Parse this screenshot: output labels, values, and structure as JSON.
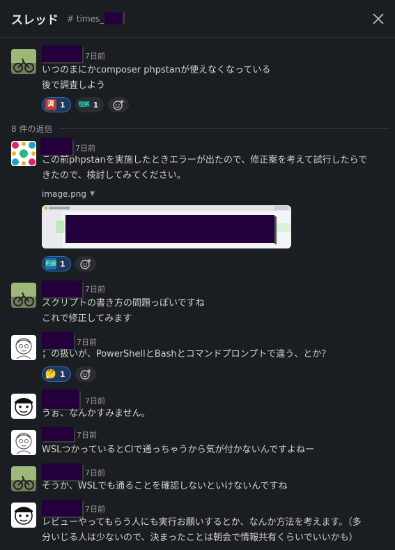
{
  "header": {
    "title": "スレッド",
    "channel": "# times_"
  },
  "parent": {
    "time": "7日前",
    "lines": [
      "いつのまにかcomposer phpstanが使えなくなっている",
      "後で調査しよう"
    ],
    "reactions": [
      {
        "emoji": "済",
        "count": "1"
      },
      {
        "emoji": "理解",
        "count": "1"
      }
    ]
  },
  "reply_divider": "8 件の返信",
  "replies": [
    {
      "time": "7日前",
      "lines": [
        "この前phpstanを実施したときエラーが出たので、修正案を考えて試行したらで",
        "きたので、検討してみてください。"
      ],
      "file_name": "image.png",
      "reactions": [
        {
          "emoji": "把握",
          "count": "1"
        }
      ]
    },
    {
      "time": "7日前",
      "lines": [
        "スクリプトの書き方の問題っぽいですね",
        "これで修正してみます"
      ]
    },
    {
      "time": "7日前",
      "lines": [
        "；の扱いが、PowerShellとBashとコマンドプロンプトで違う、とか？"
      ],
      "reactions": [
        {
          "emoji": "🤔",
          "count": "1"
        }
      ]
    },
    {
      "time": "7日前",
      "lines": [
        "うぉ、なんかすみません。"
      ]
    },
    {
      "time": "7日前",
      "lines": [
        "WSLつかっているとCIで通っちゃうから気が付かないんですよねー"
      ]
    },
    {
      "time": "7日前",
      "lines": [
        "そうか、WSLでも通ることを確認しないといけないんですね"
      ]
    },
    {
      "time": "7日前",
      "lines": [
        "レビューやってもらう人にも実行お願いするとか、なんか方法を考えます。（多",
        "分いじる人は少ないので、決まったことは朝会で情報共有くらいでいいかも）"
      ]
    }
  ],
  "colors": {
    "background": "#1a1d21",
    "redaction": "#23003c",
    "reaction_border": "#2a6fbf"
  }
}
